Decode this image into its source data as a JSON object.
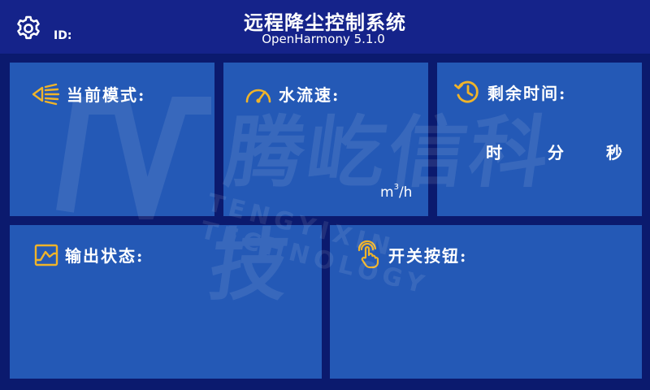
{
  "header": {
    "title": "远程降尘控制系统",
    "subtitle": "OpenHarmony 5.1.0",
    "id_label": "ID:",
    "settings_icon": "gear-icon"
  },
  "panels": {
    "current_mode": {
      "title": "当前模式:",
      "icon": "spray-nozzle-icon"
    },
    "water_flow": {
      "title": "水流速:",
      "icon": "speedometer-icon",
      "unit": "m",
      "unit_sup": "3",
      "unit_tail": "/h"
    },
    "remaining_time": {
      "title": "剩余时间:",
      "icon": "history-clock-icon",
      "hour": "时",
      "minute": "分",
      "second": "秒"
    },
    "output_state": {
      "title": "输出状态:",
      "icon": "waveform-icon"
    },
    "switch_button": {
      "title": "开关按钮:",
      "icon": "touch-hand-icon"
    }
  },
  "watermark": {
    "text": "腾屹信科技",
    "subtext": "TENGYIXIN TECHNOLOGY"
  },
  "colors": {
    "background": "#0b1a6e",
    "header": "#15238a",
    "panel": "#2459b6",
    "accent_icon": "#f0b429",
    "text": "#ffffff"
  }
}
